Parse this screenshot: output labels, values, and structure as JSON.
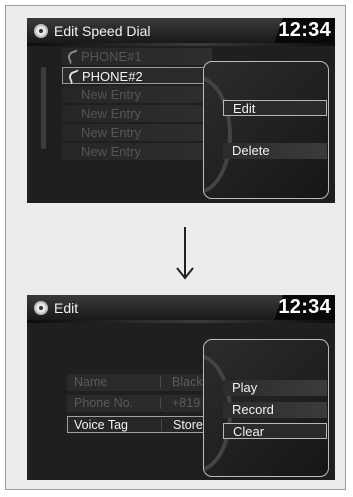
{
  "screen1": {
    "title": "Edit Speed Dial",
    "clock": "12:34",
    "list": [
      {
        "label": "PHONE#1",
        "state": "dim"
      },
      {
        "label": "PHONE#2",
        "state": "selected"
      },
      {
        "label": "New Entry",
        "state": "dim"
      },
      {
        "label": "New Entry",
        "state": "dim"
      },
      {
        "label": "New Entry",
        "state": "dim"
      },
      {
        "label": "New Entry",
        "state": "dim"
      }
    ],
    "menu": [
      "Edit",
      "Delete"
    ]
  },
  "screen2": {
    "title": "Edit",
    "clock": "12:34",
    "rows": [
      {
        "label": "Name",
        "value": "Black"
      },
      {
        "label": "Phone No.",
        "value": "+819"
      },
      {
        "label": "Voice Tag",
        "value": "Store"
      }
    ],
    "menu": [
      "Play",
      "Record",
      "Clear"
    ]
  }
}
